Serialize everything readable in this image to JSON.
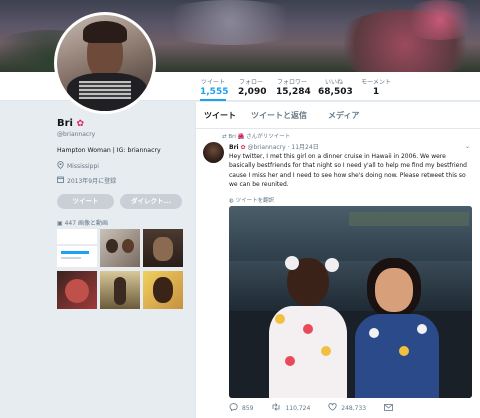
{
  "header": {
    "stats": [
      {
        "label": "ツイート",
        "value": "1,555"
      },
      {
        "label": "フォロー",
        "value": "2,090"
      },
      {
        "label": "フォロワー",
        "value": "15,284"
      },
      {
        "label": "いいね",
        "value": "68,503"
      },
      {
        "label": "モーメント",
        "value": "1"
      }
    ]
  },
  "profile": {
    "name": "Bri",
    "handle": "@briannacry",
    "bio": "Hampton Woman | IG: briannacry",
    "location": "Mississippi",
    "joined": "2013年9月に登録",
    "tweet_button": "ツイート",
    "dm_button": "ダイレクト...",
    "media_header": "447 画像と動画"
  },
  "tabs": [
    "ツイート",
    "ツイートと返信",
    "メディア"
  ],
  "tweet": {
    "retweet_line": "Bri 🌺 さんがリツイート",
    "author_name": "Bri",
    "author_handle": "@briannacry",
    "date": "· 11月24日",
    "text": "Hey twitter, I met this girl on a dinner cruise in Hawaii in 2006. We were basically bestfriends for that night so I need y'all to help me find my bestfriend cause I miss her and I need to see how she's doing now. Please retweet this so we can be reunited.",
    "translate": "ツイートを翻訳",
    "replies": "859",
    "retweets": "110,724",
    "likes": "248,733"
  },
  "colors": {
    "accent": "#1da1f2",
    "muted": "#657786",
    "like": "#e0245e"
  }
}
